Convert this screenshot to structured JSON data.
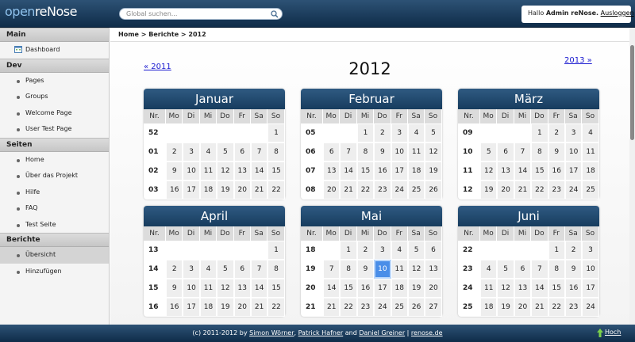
{
  "app": {
    "logo_part1": "open",
    "logo_part2": "reNose"
  },
  "search": {
    "placeholder": "Global suchen..."
  },
  "user": {
    "greeting": "Hallo",
    "name": "Admin reNose.",
    "logout": "Ausloggen"
  },
  "sidebar": {
    "sections": [
      {
        "title": "Main",
        "items": [
          {
            "label": "Dashboard",
            "icon": "calendar-icon"
          }
        ]
      },
      {
        "title": "Dev",
        "items": [
          {
            "label": "Pages"
          },
          {
            "label": "Groups"
          },
          {
            "label": "Welcome Page"
          },
          {
            "label": "User Test Page"
          }
        ]
      },
      {
        "title": "Seiten",
        "items": [
          {
            "label": "Home"
          },
          {
            "label": "Über das Projekt"
          },
          {
            "label": "Hilfe"
          },
          {
            "label": "FAQ"
          },
          {
            "label": "Test Seite"
          }
        ]
      },
      {
        "title": "Berichte",
        "items": [
          {
            "label": "Übersicht",
            "active": true
          },
          {
            "label": "Hinzufügen"
          }
        ]
      }
    ]
  },
  "breadcrumb": "Home > Berichte > 2012",
  "year_nav": {
    "prev": "« 2011",
    "title": "2012",
    "next": "2013 »"
  },
  "calendar": {
    "weekday_headers": [
      "Nr.",
      "Mo",
      "Di",
      "Mi",
      "Do",
      "Fr",
      "Sa",
      "So"
    ],
    "months": [
      {
        "name": "Januar",
        "weeks": [
          [
            "52",
            "",
            "",
            "",
            "",
            "",
            "",
            "1"
          ],
          [
            "01",
            "2",
            "3",
            "4",
            "5",
            "6",
            "7",
            "8"
          ],
          [
            "02",
            "9",
            "10",
            "11",
            "12",
            "13",
            "14",
            "15"
          ],
          [
            "03",
            "16",
            "17",
            "18",
            "19",
            "20",
            "21",
            "22"
          ]
        ]
      },
      {
        "name": "Februar",
        "weeks": [
          [
            "05",
            "",
            "",
            "1",
            "2",
            "3",
            "4",
            "5"
          ],
          [
            "06",
            "6",
            "7",
            "8",
            "9",
            "10",
            "11",
            "12"
          ],
          [
            "07",
            "13",
            "14",
            "15",
            "16",
            "17",
            "18",
            "19"
          ],
          [
            "08",
            "20",
            "21",
            "22",
            "23",
            "24",
            "25",
            "26"
          ]
        ]
      },
      {
        "name": "März",
        "weeks": [
          [
            "09",
            "",
            "",
            "",
            "1",
            "2",
            "3",
            "4"
          ],
          [
            "10",
            "5",
            "6",
            "7",
            "8",
            "9",
            "10",
            "11"
          ],
          [
            "11",
            "12",
            "13",
            "14",
            "15",
            "16",
            "17",
            "18"
          ],
          [
            "12",
            "19",
            "20",
            "21",
            "22",
            "23",
            "24",
            "25"
          ]
        ]
      },
      {
        "name": "April",
        "weeks": [
          [
            "13",
            "",
            "",
            "",
            "",
            "",
            "",
            "1"
          ],
          [
            "14",
            "2",
            "3",
            "4",
            "5",
            "6",
            "7",
            "8"
          ],
          [
            "15",
            "9",
            "10",
            "11",
            "12",
            "13",
            "14",
            "15"
          ],
          [
            "16",
            "16",
            "17",
            "18",
            "19",
            "20",
            "21",
            "22"
          ]
        ]
      },
      {
        "name": "Mai",
        "weeks": [
          [
            "18",
            "",
            "1",
            "2",
            "3",
            "4",
            "5",
            "6"
          ],
          [
            "19",
            "7",
            "8",
            "9",
            "10",
            "11",
            "12",
            "13"
          ],
          [
            "20",
            "14",
            "15",
            "16",
            "17",
            "18",
            "19",
            "20"
          ],
          [
            "21",
            "21",
            "22",
            "23",
            "24",
            "25",
            "26",
            "27"
          ]
        ],
        "today": "10"
      },
      {
        "name": "Juni",
        "weeks": [
          [
            "22",
            "",
            "",
            "",
            "",
            "1",
            "2",
            "3"
          ],
          [
            "23",
            "4",
            "5",
            "6",
            "7",
            "8",
            "9",
            "10"
          ],
          [
            "24",
            "11",
            "12",
            "13",
            "14",
            "15",
            "16",
            "17"
          ],
          [
            "25",
            "18",
            "19",
            "20",
            "21",
            "22",
            "23",
            "24"
          ]
        ]
      }
    ]
  },
  "footer": {
    "prefix": "(c) 2011-2012 by",
    "author1": "Simon Wörner",
    "author2": "Patrick Hafner",
    "and": "and",
    "author3": "Daniel Greiner",
    "site": "renose.de",
    "top": "Hoch"
  },
  "colors": {
    "header_bg": "#1c3d5e",
    "today": "#4a8ee8",
    "link": "#1a1ad0"
  }
}
